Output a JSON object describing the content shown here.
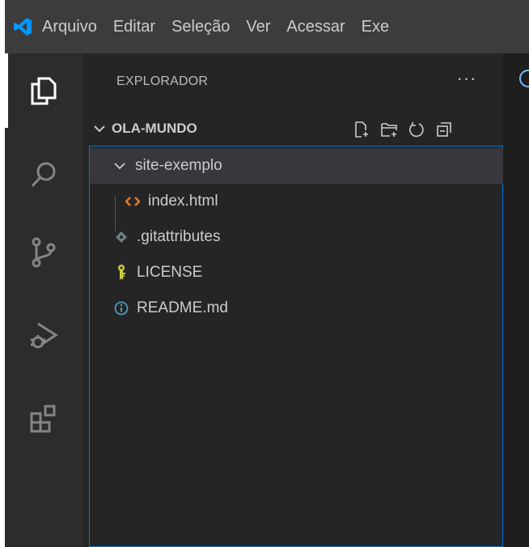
{
  "menubar": {
    "items": [
      "Arquivo",
      "Editar",
      "Seleção",
      "Ver",
      "Acessar",
      "Exe"
    ]
  },
  "activitybar": {
    "icons": [
      "explorer-icon",
      "search-icon",
      "source-control-icon",
      "run-debug-icon",
      "extensions-icon"
    ]
  },
  "explorer": {
    "title": "EXPLORADOR",
    "more_label": "···",
    "folder": {
      "name": "OLA-MUNDO",
      "actions": [
        "new-file-icon",
        "new-folder-icon",
        "refresh-icon",
        "collapse-all-icon"
      ]
    },
    "tree": [
      {
        "label": "site-exemplo",
        "type": "folder",
        "expanded": true,
        "depth": 1
      },
      {
        "label": "index.html",
        "type": "html",
        "depth": 2
      },
      {
        "label": ".gitattributes",
        "type": "git",
        "depth": 1
      },
      {
        "label": "LICENSE",
        "type": "license",
        "depth": 1
      },
      {
        "label": "README.md",
        "type": "info",
        "depth": 1
      }
    ]
  },
  "colors": {
    "accent": "#0078d4",
    "html_icon": "#e37933",
    "license_icon": "#cbcb41",
    "info_icon": "#519aba"
  }
}
